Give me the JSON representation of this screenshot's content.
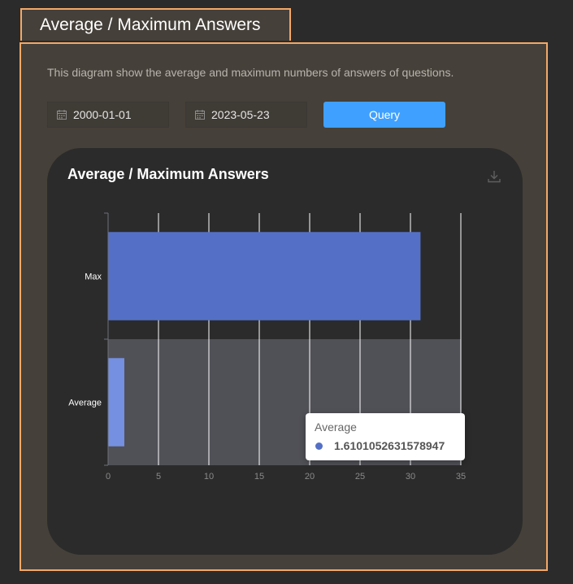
{
  "tab": {
    "title": "Average / Maximum Answers"
  },
  "description": "This diagram show the average and maximum numbers of answers of questions.",
  "filters": {
    "start_date": "2000-01-01",
    "end_date": "2023-05-23",
    "query_label": "Query",
    "calendar_icon": "calendar-icon"
  },
  "card": {
    "title": "Average / Maximum Answers",
    "download_icon": "download-icon"
  },
  "colors": {
    "accent_border": "#f3a867",
    "panel_bg": "#454039",
    "bar": "#5470c6",
    "bar_hover": "#7590e0",
    "hover_band": "#505157",
    "button": "#3fa0ff"
  },
  "tooltip": {
    "series_name": "Average",
    "value": "1.6101052631578947"
  },
  "chart_data": {
    "type": "bar",
    "orientation": "horizontal",
    "title": "Average / Maximum Answers",
    "categories": [
      "Max",
      "Average"
    ],
    "values": [
      31,
      1.6101052631578947
    ],
    "xlim": [
      0,
      35
    ],
    "xticks": [
      0,
      5,
      10,
      15,
      20,
      25,
      30,
      35
    ],
    "grid": true,
    "highlighted_category": "Average"
  }
}
